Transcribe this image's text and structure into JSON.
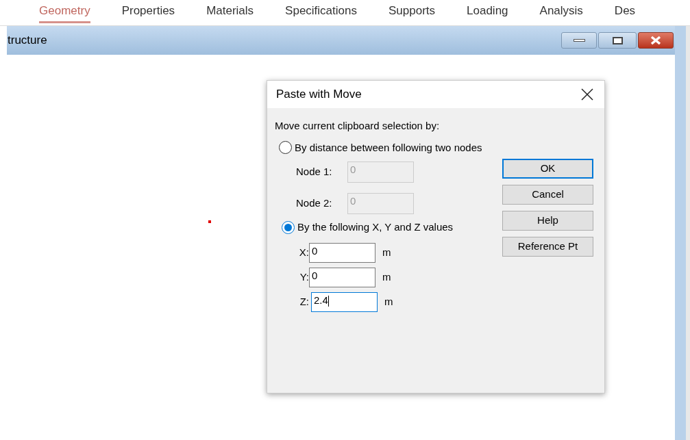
{
  "tabs": [
    {
      "label": "Geometry",
      "selected": true
    },
    {
      "label": "Properties",
      "selected": false
    },
    {
      "label": "Materials",
      "selected": false
    },
    {
      "label": "Specifications",
      "selected": false
    },
    {
      "label": "Supports",
      "selected": false
    },
    {
      "label": "Loading",
      "selected": false
    },
    {
      "label": "Analysis",
      "selected": false
    },
    {
      "label": "Des",
      "selected": false
    }
  ],
  "window": {
    "title": "tructure"
  },
  "dialog": {
    "title": "Paste with Move",
    "prompt": "Move current clipboard selection by:",
    "options": [
      {
        "kind": "nodes",
        "label": "By distance between following two nodes",
        "selected": false,
        "fields": [
          {
            "label": "Node 1:",
            "value": "0",
            "disabled": true
          },
          {
            "label": "Node 2:",
            "value": "0",
            "disabled": true
          }
        ]
      },
      {
        "kind": "xyz",
        "label": "By the following X, Y and Z values",
        "selected": true,
        "fields": [
          {
            "label": "X:",
            "value": "0",
            "unit": "m",
            "focused": false
          },
          {
            "label": "Y:",
            "value": "0",
            "unit": "m",
            "focused": false
          },
          {
            "label": "Z:",
            "value": "2.4",
            "unit": "m",
            "focused": true
          }
        ]
      }
    ],
    "buttons": [
      {
        "label": "OK",
        "default": true
      },
      {
        "label": "Cancel",
        "default": false
      },
      {
        "label": "Help",
        "default": false
      },
      {
        "label": "Reference Pt",
        "default": false
      }
    ]
  }
}
